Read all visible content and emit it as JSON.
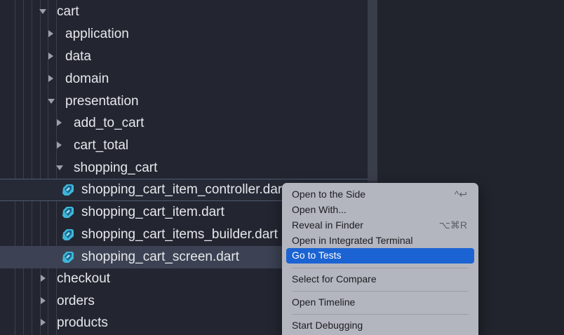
{
  "explorer": {
    "rows": [
      {
        "label": "cart",
        "twisty": "open"
      },
      {
        "label": "application",
        "twisty": "closed"
      },
      {
        "label": "data",
        "twisty": "closed"
      },
      {
        "label": "domain",
        "twisty": "closed"
      },
      {
        "label": "presentation",
        "twisty": "open"
      },
      {
        "label": "add_to_cart",
        "twisty": "closed"
      },
      {
        "label": "cart_total",
        "twisty": "closed"
      },
      {
        "label": "shopping_cart",
        "twisty": "open"
      },
      {
        "label": "shopping_cart_item_controller.dart",
        "icon": "dart-file-icon"
      },
      {
        "label": "shopping_cart_item.dart",
        "icon": "dart-file-icon"
      },
      {
        "label": "shopping_cart_items_builder.dart",
        "icon": "dart-file-icon"
      },
      {
        "label": "shopping_cart_screen.dart",
        "icon": "dart-file-icon"
      },
      {
        "label": "checkout",
        "twisty": "closed"
      },
      {
        "label": "orders",
        "twisty": "closed"
      },
      {
        "label": "products",
        "twisty": "closed"
      }
    ]
  },
  "context_menu": {
    "items": [
      {
        "label": "Open to the Side",
        "shortcut": "^↩"
      },
      {
        "label": "Open With...",
        "shortcut": ""
      },
      {
        "label": "Reveal in Finder",
        "shortcut": "⌥⌘R"
      },
      {
        "label": "Open in Integrated Terminal",
        "shortcut": ""
      },
      {
        "label": "Go to Tests",
        "shortcut": ""
      },
      {
        "label": "Select for Compare",
        "shortcut": ""
      },
      {
        "label": "Open Timeline",
        "shortcut": ""
      },
      {
        "label": "Start Debugging",
        "shortcut": ""
      }
    ],
    "highlighted_index": 4
  },
  "colors": {
    "accent": "#1b63d2",
    "dart_icon": "#3fb6d8",
    "selection": "#3c4253"
  }
}
